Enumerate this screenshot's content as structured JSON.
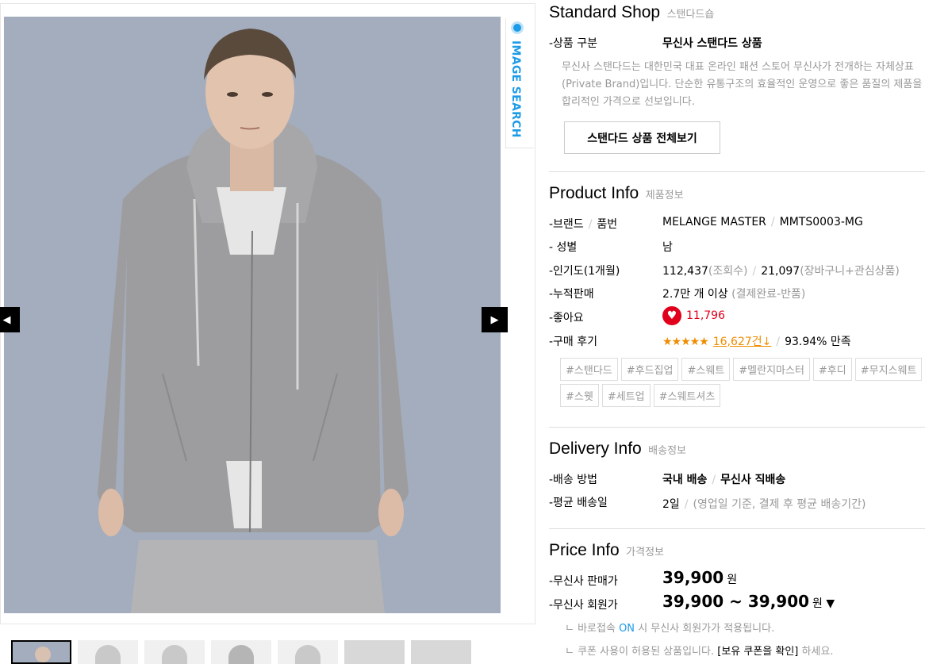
{
  "gallery": {
    "image_search_label": "IMAGE SEARCH",
    "prev_icon": "◀",
    "next_icon": "▶",
    "thumbnail_count": 7
  },
  "shop": {
    "title": "Standard Shop",
    "subtitle": "스탠다드숍",
    "category_label": "-상품 구분",
    "category_value": "무신사 스탠다드 상품",
    "description": "무신사 스탠다드는 대한민국 대표 온라인 패션 스토어 무신사가 전개하는 자체상표(Private Brand)입니다. 단순한 유통구조의 효율적인 운영으로 좋은 품질의 제품을 합리적인 가격으로 선보입니다.",
    "view_all_button": "스탠다드 상품 전체보기"
  },
  "product_info": {
    "title": "Product Info",
    "subtitle": "제품정보",
    "brand_label": "-브랜드",
    "brand_label_sep": "/",
    "brand_label2": "품번",
    "brand": "MELANGE MASTER",
    "brand_sep": "/",
    "product_code": "MMTS0003-MG",
    "gender_label": "- 성별",
    "gender": "남",
    "popularity_label": "-인기도(1개월)",
    "views": "112,437",
    "views_unit": "(조회수)",
    "pop_sep": "/",
    "carts": "21,097",
    "carts_unit": "(장바구니+관심상품)",
    "sales_label": "-누적판매",
    "sales": "2.7만 개 이상",
    "sales_note": "(결제완료-반품)",
    "likes_label": "-좋아요",
    "likes": "11,796",
    "reviews_label": "-구매 후기",
    "stars": "★★★★★",
    "review_count": "16,627건↓",
    "review_sep": "/",
    "satisfaction": "93.94% 만족",
    "tags": [
      "#스탠다드",
      "#후드집업",
      "#스웨트",
      "#멜란지마스터",
      "#후디",
      "#무지스웨트",
      "#스웻",
      "#세트업",
      "#스웨트셔츠"
    ]
  },
  "delivery_info": {
    "title": "Delivery Info",
    "subtitle": "배송정보",
    "method_label": "-배송 방법",
    "method": "국내 배송",
    "method_sep": "/",
    "method2": "무신사 직배송",
    "avg_label": "-평균 배송일",
    "avg_days": "2일",
    "avg_sep": "/",
    "avg_note": "(영업일 기준, 결제 후 평균 배송기간)"
  },
  "price_info": {
    "title": "Price Info",
    "subtitle": "가격정보",
    "sale_label": "-무신사 판매가",
    "sale_price": "39,900",
    "won": "원",
    "member_label": "-무신사 회원가",
    "member_price": "39,900 ~ 39,900",
    "dropdown_icon": "▼",
    "note1_prefix": "ㄴ 바로접속",
    "note1_on": "ON",
    "note1_suffix": "시 무신사 회원가가 적용됩니다.",
    "note2_prefix": "ㄴ 쿠폰 사용이 허용된 상품입니다.",
    "note2_link": "[보유 쿠폰을 확인]",
    "note2_suffix": "하세요."
  },
  "colors": {
    "accent_blue": "#1e9be6",
    "like_red": "#e0001b",
    "review_orange": "#f08c00",
    "photo_bg": "#a3adbd"
  }
}
